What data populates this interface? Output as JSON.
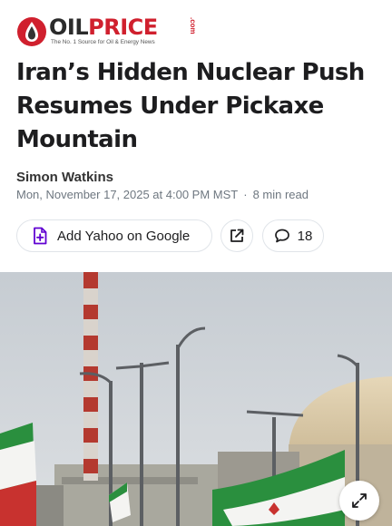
{
  "logo": {
    "word_oil": "OIL",
    "word_price": "PRICE",
    "com": ".com",
    "tagline": "The No. 1 Source for Oil & Energy News"
  },
  "article": {
    "title": "Iran’s Hidden Nuclear Push Resumes Under Pickaxe Mountain",
    "author": "Simon Watkins",
    "date": "Mon, November 17, 2025 at 4:00 PM MST",
    "separator": "·",
    "read_time": "8 min read"
  },
  "actions": {
    "yahoo_label": "Add Yahoo on Google",
    "comments_count": "18"
  },
  "icons": {
    "logo": "oil-drop-logo-icon",
    "yahoo": "yahoo-plus-doc-icon",
    "share": "external-share-icon",
    "comments": "speech-bubble-icon",
    "expand": "expand-arrows-icon"
  },
  "colors": {
    "brand_red": "#d0202e",
    "yahoo_purple": "#6001d2"
  },
  "image": {
    "subject": "photo of nuclear plant with iranian flags and street lights"
  }
}
